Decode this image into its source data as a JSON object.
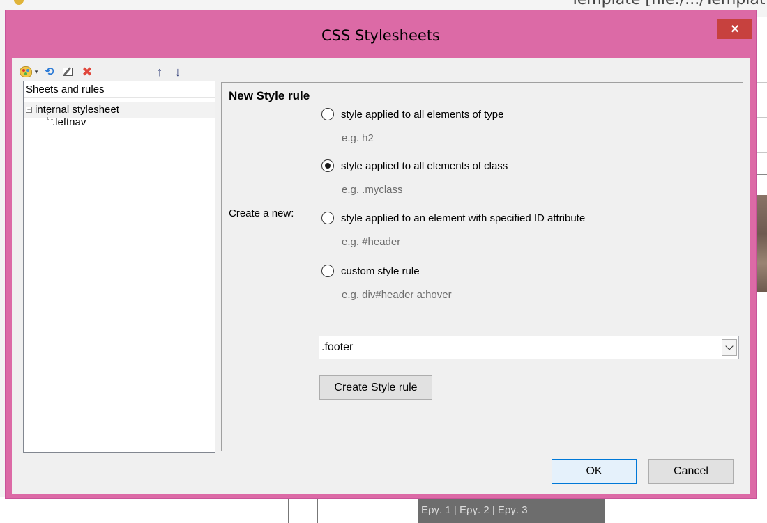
{
  "background": {
    "window_title": "Template [file:/.../Templat",
    "bottom_nav": "Εργ. 1 | Εργ. 2 | Εργ. 3"
  },
  "dialog": {
    "title": "CSS Stylesheets",
    "close_label": "×",
    "toolbar": {
      "icons": [
        "palette-icon",
        "dropdown-arrow-icon",
        "refresh-icon",
        "edit-icon",
        "delete-icon",
        "move-up-icon",
        "move-down-icon"
      ],
      "dropdown_glyph": "▾",
      "refresh_glyph": "⟲",
      "delete_glyph": "✖",
      "up_glyph": "↑",
      "down_glyph": "↓"
    },
    "tree": {
      "header": "Sheets and rules",
      "items": [
        {
          "label": "internal stylesheet",
          "expander": "−"
        },
        {
          "label": ".leftnav"
        }
      ]
    },
    "rule": {
      "title": "New Style rule",
      "create_label": "Create a new:",
      "options": [
        {
          "label": "style applied to all elements of type",
          "example": "e.g. h2",
          "checked": false
        },
        {
          "label": "style applied to all elements of class",
          "example": "e.g. .myclass",
          "checked": true
        },
        {
          "label": "style applied to an element with specified ID attribute",
          "example": "e.g. #header",
          "checked": false
        },
        {
          "label": "custom style rule",
          "example": "e.g. div#header a:hover",
          "checked": false
        }
      ],
      "selector_value": ".footer",
      "create_button": "Create Style rule"
    },
    "ok_label": "OK",
    "cancel_label": "Cancel"
  },
  "colors": {
    "title_bar": "#dc6aa6",
    "close_button": "#c7413e",
    "ok_border": "#0078d7"
  }
}
